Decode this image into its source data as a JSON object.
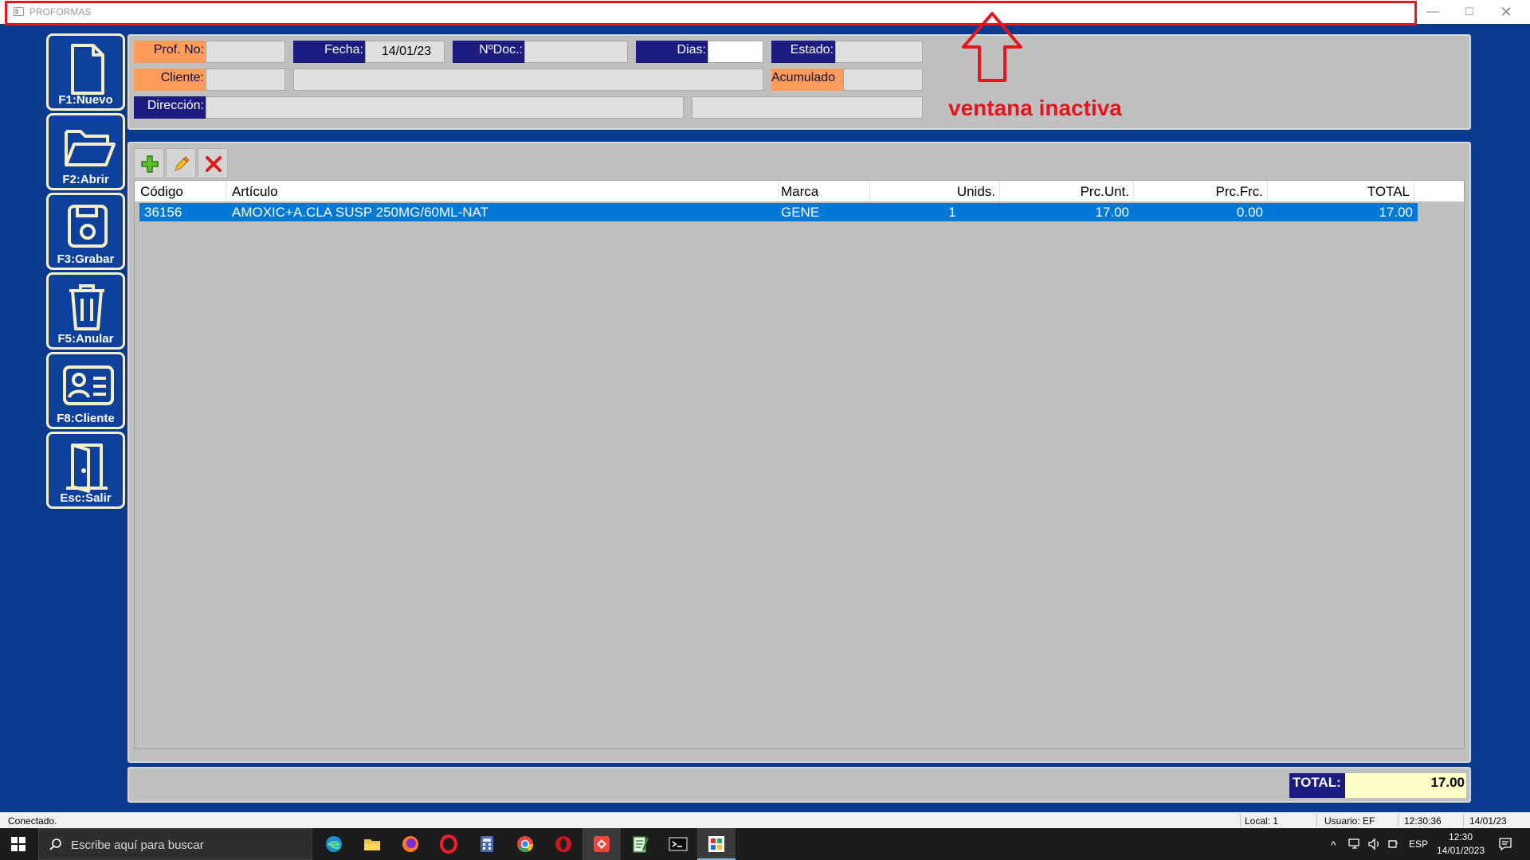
{
  "window": {
    "title": "PROFORMAS",
    "controls": {
      "minimize": "—",
      "maximize": "☐",
      "close": "✕"
    }
  },
  "sidebar": {
    "items": [
      {
        "label": "F1:Nuevo",
        "icon": "new-document-icon"
      },
      {
        "label": "F2:Abrir",
        "icon": "open-folder-icon"
      },
      {
        "label": "F3:Grabar",
        "icon": "save-disk-icon"
      },
      {
        "label": "F5:Anular",
        "icon": "trash-icon"
      },
      {
        "label": "F8:Cliente",
        "icon": "client-card-icon"
      },
      {
        "label": "Esc:Salir",
        "icon": "exit-door-icon"
      }
    ]
  },
  "header": {
    "prof_no": {
      "label": "Prof. No:",
      "value": ""
    },
    "fecha": {
      "label": "Fecha:",
      "value": "14/01/23"
    },
    "nro_doc": {
      "label": "NºDoc.:",
      "value": ""
    },
    "dias": {
      "label": "Dias:",
      "value": ""
    },
    "estado": {
      "label": "Estado:",
      "value": ""
    },
    "cliente": {
      "label": "Cliente:",
      "code": "",
      "name": ""
    },
    "acumulado": {
      "label": "Acumulado",
      "value": ""
    },
    "direccion": {
      "label": "Dirección:",
      "line1": "",
      "line2": ""
    }
  },
  "annotation": {
    "text": "ventana inactiva",
    "color": "#e8141c"
  },
  "grid_toolbar": {
    "add": "add-row-icon",
    "edit": "edit-row-icon",
    "delete": "delete-row-icon"
  },
  "grid": {
    "columns": [
      "Código",
      "Artículo",
      "Marca",
      "Unids.",
      "Prc.Unt.",
      "Prc.Frc.",
      "TOTAL"
    ],
    "rows": [
      {
        "codigo": "36156",
        "articulo": "AMOXIC+A.CLA SUSP 250MG/60ML-NAT",
        "marca": "GENE",
        "unids": "1",
        "prc_unt": "17.00",
        "prc_frc": "0.00",
        "total": "17.00"
      }
    ]
  },
  "footer": {
    "total_label": "TOTAL:",
    "total_value": "17.00"
  },
  "statusbar": {
    "status": "Conectado.",
    "local": "Local: 1",
    "usuario": "Usuario: EF",
    "time": "12:30:36",
    "date": "14/01/23"
  },
  "taskbar": {
    "search_placeholder": "Escribe aquí para buscar",
    "language": "ESP",
    "clock_time": "12:30",
    "clock_date": "14/01/2023"
  },
  "colors": {
    "window_bg": "#0a3a8c",
    "panel_bg": "#c0c0c0",
    "label_orange": "#ff9c5a",
    "label_navy": "#1c1c80",
    "selection": "#0078d7",
    "total_bg": "#ffffc8"
  }
}
